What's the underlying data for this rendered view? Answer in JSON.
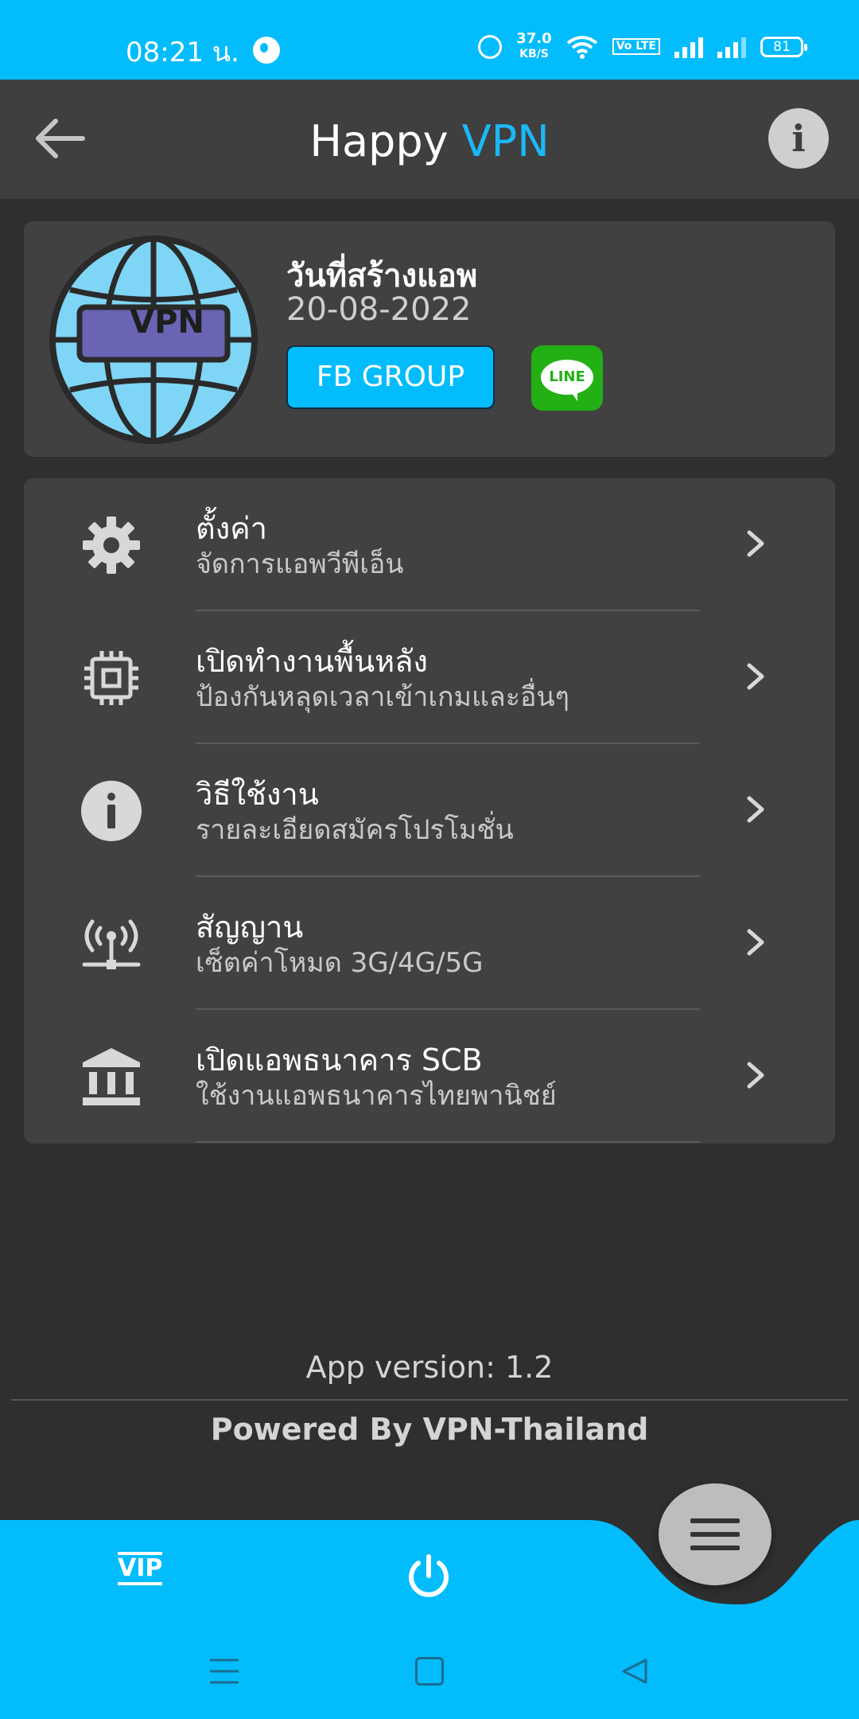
{
  "status_bar": {
    "time": "08:21 น.",
    "net_speed_value": "37.0",
    "net_speed_unit": "KB/S",
    "volte": "Vo LTE",
    "battery": "81"
  },
  "app_bar": {
    "title_part1": "Happy",
    "title_part2": "VPN"
  },
  "header": {
    "logo_text": "VPN",
    "created_label": "วันที่สร้างแอพ",
    "created_date": "20-08-2022",
    "fb_button": "FB GROUP",
    "line_label": "LINE"
  },
  "menu": [
    {
      "icon": "gear-icon",
      "title": "ตั้งค่า",
      "subtitle": "จัดการแอพวีพีเอ็น"
    },
    {
      "icon": "chip-icon",
      "title": "เปิดทำงานพื้นหลัง",
      "subtitle": "ป้องกันหลุดเวลาเข้าเกมและอื่นๆ"
    },
    {
      "icon": "info-icon",
      "title": "วิธีใช้งาน",
      "subtitle": "รายละเอียดสมัครโปรโมชั่น"
    },
    {
      "icon": "signal-tower-icon",
      "title": "สัญญาน",
      "subtitle": "เซ็ตค่าโหมด 3G/4G/5G"
    },
    {
      "icon": "bank-icon",
      "title": "เปิดแอพธนาคาร SCB",
      "subtitle": "ใช้งานแอพธนาคารไทยพานิชย์"
    }
  ],
  "footer": {
    "version": "App version: 1.2",
    "powered": "Powered By VPN-Thailand"
  },
  "bottom_nav": {
    "vip_label": "VIP"
  },
  "colors": {
    "accent": "#03bcfb",
    "background": "#2f2f2f",
    "card": "#414141",
    "line_green": "#22b014"
  }
}
